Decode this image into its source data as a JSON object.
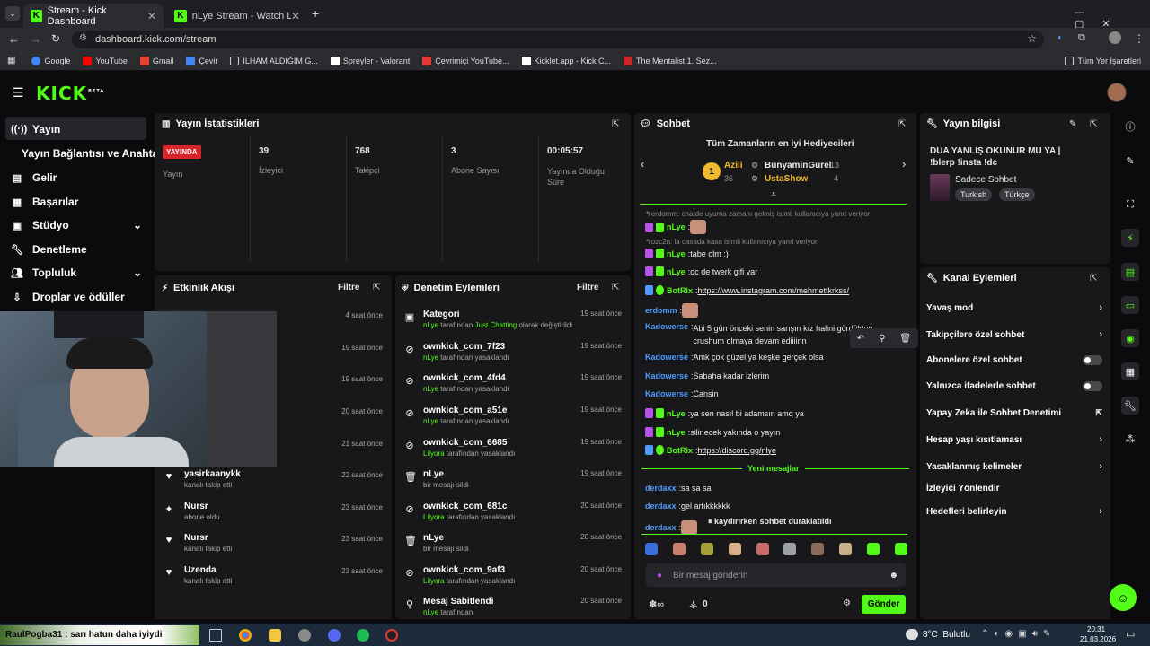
{
  "browser": {
    "tabs": [
      {
        "title": "Stream - Kick Dashboard"
      },
      {
        "title": "nLye Stream - Watch Live on Ki"
      }
    ],
    "url": "dashboard.kick.com/stream",
    "bookmarks": [
      "Google",
      "YouTube",
      "Gmail",
      "Çevir",
      "İLHAM ALDIĞIM G...",
      "Spreyler - Valorant",
      "Çevrimiçi YouTube...",
      "Kicklet.app - Kick C...",
      "The Mentalist 1. Sez..."
    ],
    "all_bookmarks": "Tüm Yer İşaretleri"
  },
  "brand": {
    "logo": "KICK",
    "beta": "BETA",
    "accent": "#53fc18"
  },
  "sidebar": {
    "items": [
      {
        "label": "Yayın"
      },
      {
        "label": "Yayın Bağlantısı ve Anahtarı"
      },
      {
        "label": "Gelir"
      },
      {
        "label": "Başarılar"
      },
      {
        "label": "Stüdyo"
      },
      {
        "label": "Denetleme"
      },
      {
        "label": "Topluluk"
      },
      {
        "label": "Droplar ve ödüller"
      }
    ]
  },
  "stats": {
    "title": "Yayın İstatistikleri",
    "live_badge": "YAYINDA",
    "live_label": "Yayın",
    "viewers": "39",
    "viewers_label": "İzleyici",
    "followers": "768",
    "followers_label": "Takipçi",
    "subs": "3",
    "subs_label": "Abone Sayısı",
    "uptime": "00:05:57",
    "uptime_label": "Yayında Olduğu Süre"
  },
  "activity": {
    "title": "Etkinlik Akışı",
    "filter": "Filtre",
    "items": [
      {
        "name": "",
        "sub": "",
        "time": "4 saat önce"
      },
      {
        "name": "",
        "sub": "",
        "time": "19 saat önce"
      },
      {
        "name": "31",
        "sub": "",
        "time": "19 saat önce"
      },
      {
        "name": "",
        "sub": "",
        "time": "20 saat önce"
      },
      {
        "name": "",
        "sub": "",
        "time": "21 saat önce"
      },
      {
        "name": "yasirkaanykk",
        "sub": "kanalı takip etti",
        "time": "22 saat önce"
      },
      {
        "name": "Nursr",
        "sub": "abone oldu",
        "time": "23 saat önce"
      },
      {
        "name": "Nursr",
        "sub": "kanalı takip etti",
        "time": "23 saat önce"
      },
      {
        "name": "Uzenda",
        "sub": "kanalı takip etti",
        "time": "23 saat önce"
      }
    ]
  },
  "moderation": {
    "title": "Denetim Eylemleri",
    "filter": "Filtre",
    "items": [
      {
        "name": "Kategori",
        "by": "nLye",
        "sub": " tarafından ",
        "extra": "Just Chatting",
        "sub2": " olarak değiştirildi",
        "time": "19 saat önce"
      },
      {
        "name": "ownkick_com_7f23",
        "by": "nLye",
        "sub": " tarafından yasaklandı",
        "time": "19 saat önce"
      },
      {
        "name": "ownkick_com_4fd4",
        "by": "nLye",
        "sub": " tarafından yasaklandı",
        "time": "19 saat önce"
      },
      {
        "name": "ownkick_com_a51e",
        "by": "nLye",
        "sub": " tarafından yasaklandı",
        "time": "19 saat önce"
      },
      {
        "name": "ownkick_com_6685",
        "by": "Lilyora",
        "sub": " tarafından yasaklandı",
        "time": "19 saat önce"
      },
      {
        "name": "nLye",
        "by": "",
        "sub": "bir mesajı sildi",
        "time": "19 saat önce"
      },
      {
        "name": "ownkick_com_681c",
        "by": "Lilyora",
        "sub": " tarafından yasaklandı",
        "time": "20 saat önce"
      },
      {
        "name": "nLye",
        "by": "",
        "sub": "bir mesajı sildi",
        "time": "20 saat önce"
      },
      {
        "name": "ownkick_com_9af3",
        "by": "Lilyora",
        "sub": " tarafından yasaklandı",
        "time": "20 saat önce"
      },
      {
        "name": "Mesaj Sabitlendi",
        "by": "nLye",
        "sub": " tarafından",
        "time": "20 saat önce"
      }
    ]
  },
  "chat": {
    "title": "Sohbet",
    "top_gifters_title": "Tüm Zamanların en iyi Hediyecileri",
    "gifters": [
      {
        "rank": "1",
        "name": "Azili",
        "count": "36"
      },
      {
        "name": "BunyaminGurel",
        "count": "13"
      },
      {
        "name": "UstaShow",
        "count": "4"
      }
    ],
    "messages": [
      {
        "reply": "erdomm: chatde uyuma zamanı gelmiş isimli kullanıcıya yanıt veriyor"
      },
      {
        "user": "nLye",
        "text": "",
        "color": "#53fc18"
      },
      {
        "reply": "ozc2n: la casada kasa isimli kullanıcıya yanıt veriyor"
      },
      {
        "user": "nLye",
        "text": "tabe olm :)",
        "color": "#53fc18"
      },
      {
        "user": "nLye",
        "text": "dc de twerk gifi var",
        "color": "#53fc18"
      },
      {
        "user": "BotRix",
        "text": "https://www.instagram.com/mehmettkrkss/",
        "color": "#53fc18"
      },
      {
        "user": "erdomm",
        "text": "",
        "color": "#4f9cff"
      },
      {
        "user": "Kadowerse",
        "text": "Abi 5 gün önceki senin sarışın kız halini gördükten crushum olmaya devam ediiiinn",
        "color": "#4f9cff"
      },
      {
        "user": "Kadowerse",
        "text": "Amk çok güzel ya keşke gerçek olsa",
        "color": "#4f9cff"
      },
      {
        "user": "Kadowerse",
        "text": "Sabaha kadar izlerim",
        "color": "#4f9cff"
      },
      {
        "user": "Kadowerse",
        "text": "Cansin",
        "color": "#4f9cff"
      },
      {
        "user": "nLye",
        "text": "ya sen nasıl bi adamsın amq ya",
        "color": "#53fc18"
      },
      {
        "user": "nLye",
        "text": "silinecek yakında o yayın",
        "color": "#53fc18"
      },
      {
        "user": "BotRix",
        "text": "https://discord.gg/nlye",
        "color": "#53fc18"
      },
      {
        "user": "derdaxx",
        "text": "sa sa sa",
        "color": "#4f9cff"
      },
      {
        "user": "derdaxx",
        "text": "gel artıkkkkkk",
        "color": "#4f9cff"
      },
      {
        "user": "derdaxx",
        "text": "",
        "color": "#4f9cff"
      }
    ],
    "new_messages": "Yeni mesajlar",
    "paused": "kaydırırken sohbet duraklatıldı",
    "input_placeholder": "Bir mesaj gönderin",
    "count": "0",
    "send": "Gönder"
  },
  "stream_info": {
    "title": "Yayın bilgisi",
    "stream_title": "DUA YANLIŞ OKUNUR MU YA | !blerp !insta !dc",
    "category": "Sadece Sohbet",
    "tags": [
      "Turkish",
      "Türkçe"
    ]
  },
  "channel_actions": {
    "title": "Kanal Eylemleri",
    "items": [
      {
        "label": "Yavaş mod",
        "kind": "arrow"
      },
      {
        "label": "Takipçilere özel sohbet",
        "kind": "arrow"
      },
      {
        "label": "Abonelere özel sohbet",
        "kind": "toggle"
      },
      {
        "label": "Yalnızca ifadelerle sohbet",
        "kind": "toggle"
      },
      {
        "label": "Yapay Zeka ile Sohbet Denetimi",
        "kind": "ext"
      },
      {
        "label": "Hesap yaşı kısıtlaması",
        "kind": "arrow"
      },
      {
        "label": "Yasaklanmış kelimeler",
        "kind": "arrow"
      },
      {
        "label": "İzleyici Yönlendir",
        "kind": "none"
      },
      {
        "label": "Hedefleri belirleyin",
        "kind": "arrow"
      }
    ]
  },
  "overlay": {
    "webcam_chat": "RaulPogba31 : sarı hatun daha iyiydi"
  },
  "taskbar": {
    "weather": "8°C  Bulutlu",
    "time": "20:31",
    "date": "21.03.2026"
  }
}
